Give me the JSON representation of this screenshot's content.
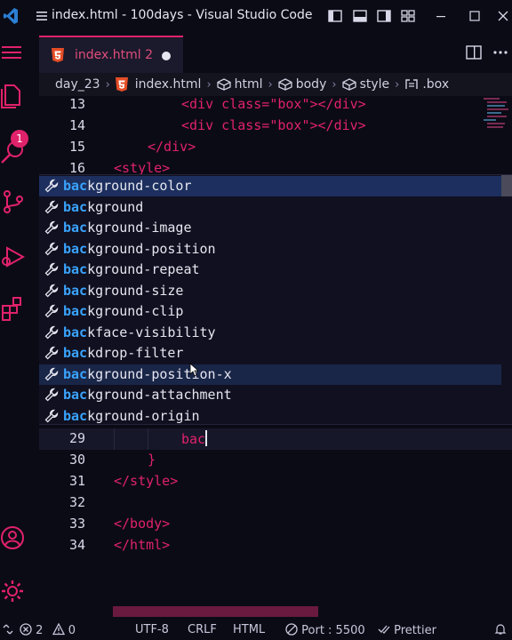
{
  "window": {
    "title": "index.html - 100days - Visual Studio Code"
  },
  "tab": {
    "label": "index.html",
    "problem_count": "2"
  },
  "activity": {
    "badge": "1"
  },
  "breadcrumb": {
    "items": [
      "day_23",
      "index.html",
      "html",
      "body",
      "style",
      ".box"
    ]
  },
  "editor": {
    "lines": [
      {
        "num": "13",
        "code": "<div class=\"box\"></div>"
      },
      {
        "num": "14",
        "code": "<div class=\"box\"></div>"
      },
      {
        "num": "15",
        "code": "</div>"
      },
      {
        "num": "16",
        "code": "<style>"
      },
      {
        "num": "29",
        "code": "bac"
      },
      {
        "num": "30",
        "code": "}"
      },
      {
        "num": "31",
        "code": "</style>"
      },
      {
        "num": "32",
        "code": ""
      },
      {
        "num": "33",
        "code": "</body>"
      },
      {
        "num": "34",
        "code": "</html>"
      }
    ]
  },
  "suggest": {
    "typed": "bac",
    "items": [
      {
        "prefix": "bac",
        "rest": "kground-color"
      },
      {
        "prefix": "bac",
        "rest": "kground"
      },
      {
        "prefix": "bac",
        "rest": "kground-image"
      },
      {
        "prefix": "bac",
        "rest": "kground-position"
      },
      {
        "prefix": "bac",
        "rest": "kground-repeat"
      },
      {
        "prefix": "bac",
        "rest": "kground-size"
      },
      {
        "prefix": "bac",
        "rest": "kground-clip"
      },
      {
        "prefix": "bac",
        "rest": "kface-visibility"
      },
      {
        "prefix": "bac",
        "rest": "kdrop-filter"
      },
      {
        "prefix": "bac",
        "rest": "kground-position-x"
      },
      {
        "prefix": "bac",
        "rest": "kground-attachment"
      },
      {
        "prefix": "bac",
        "rest": "kground-origin"
      }
    ]
  },
  "status": {
    "errors": "2",
    "warnings": "0",
    "encoding": "UTF-8",
    "eol": "CRLF",
    "language": "HTML",
    "port": "Port : 5500",
    "formatter": "Prettier"
  },
  "colors": {
    "accent": "#e0226a",
    "suggest_highlight": "#3aa4ff",
    "focused_row": "#1c2f5e"
  }
}
